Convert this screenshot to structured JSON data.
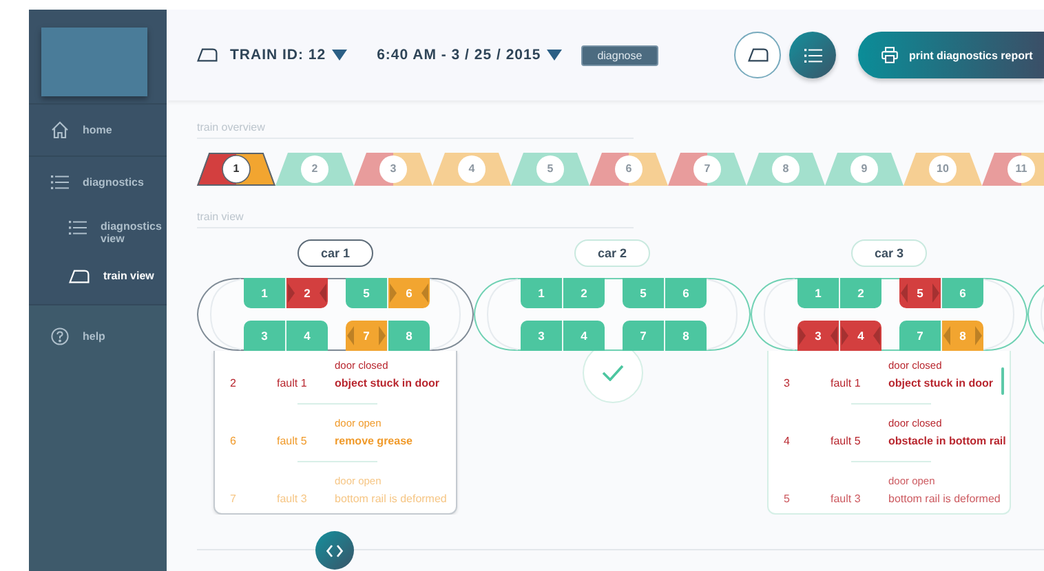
{
  "sidebar": {
    "items": [
      {
        "label": "home",
        "selected": false
      },
      {
        "label": "diagnostics",
        "selected": false,
        "expanded": true,
        "children": [
          {
            "label": "diagnostics view",
            "selected": false
          },
          {
            "label": "train view",
            "selected": true
          }
        ]
      },
      {
        "label": "help",
        "selected": false
      }
    ]
  },
  "header": {
    "train_id": "TRAIN ID: 12",
    "datetime": "6:40 AM  -  3 / 25 / 2015",
    "diagnose_button": "diagnose",
    "view_toggles": [
      {
        "selected": false
      },
      {
        "selected": true
      }
    ],
    "print_button": "print diagnostics report"
  },
  "overview": {
    "label": "train overview",
    "cars": [
      {
        "number": "1",
        "selected": true,
        "halves": [
          {
            "color": "#d33f3f"
          },
          {
            "color": "#f2a530"
          }
        ]
      },
      {
        "number": "2",
        "selected": false,
        "halves": [
          {
            "color": "#a3e0cd"
          },
          {
            "color": "#a3e0cd"
          }
        ]
      },
      {
        "number": "3",
        "selected": false,
        "halves": [
          {
            "color": "#e89c9c"
          },
          {
            "color": "#f6cf93"
          }
        ]
      },
      {
        "number": "4",
        "selected": false,
        "halves": [
          {
            "color": "#f6cf93"
          },
          {
            "color": "#f6cf93"
          }
        ]
      },
      {
        "number": "5",
        "selected": false,
        "halves": [
          {
            "color": "#a3e0cd"
          },
          {
            "color": "#a3e0cd"
          }
        ]
      },
      {
        "number": "6",
        "selected": false,
        "halves": [
          {
            "color": "#e89c9c"
          },
          {
            "color": "#f6cf93"
          }
        ]
      },
      {
        "number": "7",
        "selected": false,
        "halves": [
          {
            "color": "#e89c9c"
          },
          {
            "color": "#a3e0cd"
          }
        ]
      },
      {
        "number": "8",
        "selected": false,
        "halves": [
          {
            "color": "#a3e0cd"
          },
          {
            "color": "#a3e0cd"
          }
        ]
      },
      {
        "number": "9",
        "selected": false,
        "halves": [
          {
            "color": "#a3e0cd"
          },
          {
            "color": "#a3e0cd"
          }
        ]
      },
      {
        "number": "10",
        "selected": false,
        "halves": [
          {
            "color": "#f6cf93"
          },
          {
            "color": "#f6cf93"
          }
        ]
      },
      {
        "number": "11",
        "selected": false,
        "halves": [
          {
            "color": "#e89c9c"
          },
          {
            "color": "#f6cf93"
          }
        ]
      }
    ]
  },
  "train": {
    "label": "train view",
    "cars": [
      {
        "label": "car 1",
        "selected": true,
        "doors": [
          {
            "number": "1",
            "color": "#4cc6a0",
            "kind": "plain"
          },
          {
            "number": "2",
            "color": "#d33f3f",
            "kind": "closing"
          },
          {
            "number": "5",
            "color": "#4cc6a0",
            "kind": "plain"
          },
          {
            "number": "6",
            "color": "#f2a530",
            "kind": "closing"
          },
          {
            "number": "3",
            "color": "#4cc6a0",
            "kind": "plain"
          },
          {
            "number": "4",
            "color": "#4cc6a0",
            "kind": "plain"
          },
          {
            "number": "7",
            "color": "#f2a530",
            "kind": "opening"
          },
          {
            "number": "8",
            "color": "#4cc6a0",
            "kind": "plain"
          }
        ],
        "scrollable": false,
        "faults": [
          {
            "door": "2",
            "fault": "fault 1",
            "state": "door closed",
            "description": "object stuck in door",
            "color": "#b8262e",
            "faded": false
          },
          {
            "door": "6",
            "fault": "fault 5",
            "state": "door open",
            "description": "remove grease",
            "color": "#f09a2a",
            "faded": false
          },
          {
            "door": "7",
            "fault": "fault 3",
            "state": "door open",
            "description": "bottom rail is deformed",
            "color": "#f6c685",
            "faded": true
          }
        ]
      },
      {
        "label": "car 2",
        "selected": false,
        "doors": [
          {
            "number": "1",
            "color": "#4cc6a0",
            "kind": "plain"
          },
          {
            "number": "2",
            "color": "#4cc6a0",
            "kind": "plain"
          },
          {
            "number": "5",
            "color": "#4cc6a0",
            "kind": "plain"
          },
          {
            "number": "6",
            "color": "#4cc6a0",
            "kind": "plain"
          },
          {
            "number": "3",
            "color": "#4cc6a0",
            "kind": "plain"
          },
          {
            "number": "4",
            "color": "#4cc6a0",
            "kind": "plain"
          },
          {
            "number": "7",
            "color": "#4cc6a0",
            "kind": "plain"
          },
          {
            "number": "8",
            "color": "#4cc6a0",
            "kind": "plain"
          }
        ]
      },
      {
        "label": "car 3",
        "selected": false,
        "doors": [
          {
            "number": "1",
            "color": "#4cc6a0",
            "kind": "plain"
          },
          {
            "number": "2",
            "color": "#4cc6a0",
            "kind": "plain"
          },
          {
            "number": "5",
            "color": "#d33f3f",
            "kind": "opening"
          },
          {
            "number": "6",
            "color": "#4cc6a0",
            "kind": "plain"
          },
          {
            "number": "3",
            "color": "#d33f3f",
            "kind": "closing"
          },
          {
            "number": "4",
            "color": "#d33f3f",
            "kind": "closing"
          },
          {
            "number": "7",
            "color": "#4cc6a0",
            "kind": "plain"
          },
          {
            "number": "8",
            "color": "#f2a530",
            "kind": "opening"
          }
        ],
        "scrollable": true,
        "faults": [
          {
            "door": "3",
            "fault": "fault 1",
            "state": "door closed",
            "description": "object stuck in door",
            "color": "#b8262e",
            "faded": false
          },
          {
            "door": "4",
            "fault": "fault 5",
            "state": "door closed",
            "description": "obstacle in bottom rail",
            "color": "#b8262e",
            "faded": false
          },
          {
            "door": "5",
            "fault": "fault 3",
            "state": "door open",
            "description": "bottom rail is deformed",
            "color": "#cc5a60",
            "faded": true
          }
        ]
      }
    ]
  }
}
